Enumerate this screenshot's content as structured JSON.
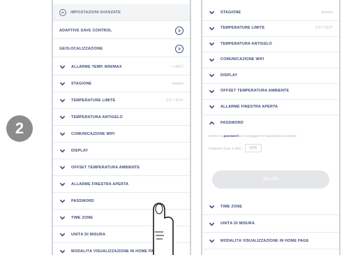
{
  "step": {
    "number": "2"
  },
  "left_screen": {
    "header": {
      "label": "IMPOSTAZIONI AVANZATE"
    },
    "toggles": [
      {
        "label": "ADAPTIVE SAVE CONTROL"
      },
      {
        "label": "GEOLOCALIZZAZIONE"
      }
    ],
    "rows": [
      {
        "label": "ALLARME TEMP. MIN/MAX",
        "value": "- / +60°C"
      },
      {
        "label": "STAGIONE",
        "value": "Inverno"
      },
      {
        "label": "TEMPERATURE LIMITE",
        "value": "5.0° / 30.0°"
      },
      {
        "label": "TEMPERATURA ANTIGELO",
        "value": ""
      },
      {
        "label": "COMUNICAZIONE WIFI",
        "value": ""
      },
      {
        "label": "DISPLAY",
        "value": ""
      },
      {
        "label": "OFFSET TEMPERATURA AMBIENTE",
        "value": ""
      },
      {
        "label": "ALLARME FINESTRA APERTA",
        "value": ""
      },
      {
        "label": "PASSWORD",
        "value": ""
      },
      {
        "label": "TIME ZONE",
        "value": ""
      },
      {
        "label": "UNITÀ DI MISURA",
        "value": ""
      },
      {
        "label": "MODALITÀ VISUALIZZAZIONE IN HOME PAGE",
        "value": ""
      }
    ]
  },
  "right_screen": {
    "rows_top": [
      {
        "label": "STAGIONE",
        "value": "Inverno"
      },
      {
        "label": "TEMPERATURE LIMITE",
        "value": "5.0° / 30.0°"
      },
      {
        "label": "TEMPERATURA ANTIGELO",
        "value": ""
      },
      {
        "label": "COMUNICAZIONE WIFI",
        "value": ""
      },
      {
        "label": "DISPLAY",
        "value": ""
      },
      {
        "label": "OFFSET TEMPERATURA AMBIENTE",
        "value": ""
      },
      {
        "label": "ALLARME FINESTRA APERTA",
        "value": ""
      }
    ],
    "password": {
      "label": "PASSWORD",
      "desc_prefix": "Inserire la",
      "desc_bold": "password",
      "desc_suffix": "per proteggere le impostazioni avanzate",
      "field_label": "Password (max 4 cifre)",
      "field_value": "0000"
    },
    "save_label": "SALVA",
    "rows_bottom": [
      {
        "label": "TIME ZONE",
        "value": ""
      },
      {
        "label": "UNITÀ DI MISURA",
        "value": ""
      },
      {
        "label": "MODALITÀ VISUALIZZAZIONE IN HOME PAGE",
        "value": ""
      }
    ]
  },
  "icons": {
    "row_toggle": "chevron-down-icon",
    "toggle_info": "circle-chevron-icon",
    "header": "circle-chevron-up-icon",
    "gesture": "tap-hand-icon"
  },
  "colors": {
    "label": "#3e4d7b",
    "badge": "#8c8c8c",
    "muted": "#b9bec7"
  }
}
